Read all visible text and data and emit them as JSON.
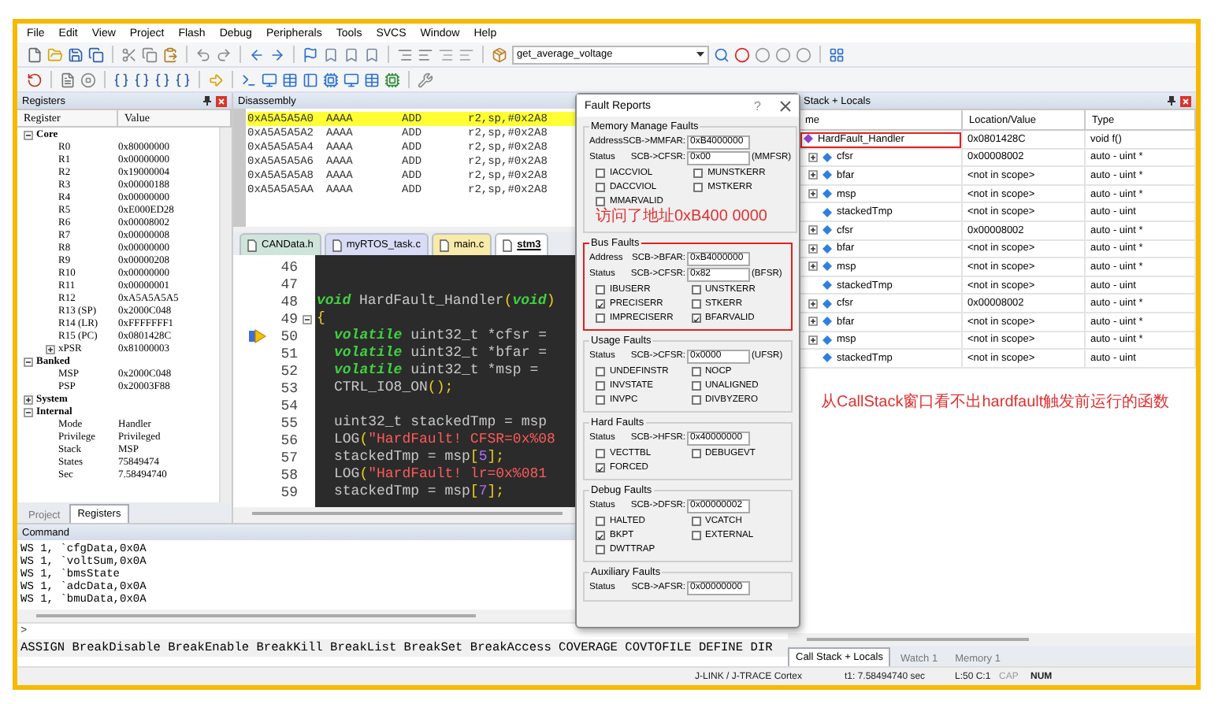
{
  "window": {
    "menu": [
      "File",
      "Edit",
      "View",
      "Project",
      "Flash",
      "Debug",
      "Peripherals",
      "Tools",
      "SVCS",
      "Window",
      "Help"
    ]
  },
  "toolbar": {
    "target": "get_average_voltage"
  },
  "registers": {
    "title": "Registers",
    "columns": [
      "Register",
      "Value"
    ],
    "items": [
      {
        "name": "Core",
        "expanded": true,
        "children": [
          {
            "name": "R0",
            "value": "0x80000000"
          },
          {
            "name": "R1",
            "value": "0x00000000"
          },
          {
            "name": "R2",
            "value": "0x19000004"
          },
          {
            "name": "R3",
            "value": "0x00000188"
          },
          {
            "name": "R4",
            "value": "0x00000000"
          },
          {
            "name": "R5",
            "value": "0xE000ED28"
          },
          {
            "name": "R6",
            "value": "0x00008002"
          },
          {
            "name": "R7",
            "value": "0x00000008"
          },
          {
            "name": "R8",
            "value": "0x00000000"
          },
          {
            "name": "R9",
            "value": "0x00000208"
          },
          {
            "name": "R10",
            "value": "0x00000000"
          },
          {
            "name": "R11",
            "value": "0x00000001"
          },
          {
            "name": "R12",
            "value": "0xA5A5A5A5"
          },
          {
            "name": "R13 (SP)",
            "value": "0x2000C048"
          },
          {
            "name": "R14 (LR)",
            "value": "0xFFFFFFF1"
          },
          {
            "name": "R15 (PC)",
            "value": "0x0801428C"
          },
          {
            "name": "xPSR",
            "value": "0x81000003",
            "expanded": false
          }
        ]
      },
      {
        "name": "Banked",
        "expanded": true,
        "children": [
          {
            "name": "MSP",
            "value": "0x2000C048"
          },
          {
            "name": "PSP",
            "value": "0x20003F88"
          }
        ]
      },
      {
        "name": "System",
        "expanded": false
      },
      {
        "name": "Internal",
        "expanded": true,
        "children": [
          {
            "name": "Mode",
            "value": "Handler"
          },
          {
            "name": "Privilege",
            "value": "Privileged"
          },
          {
            "name": "Stack",
            "value": "MSP"
          },
          {
            "name": "States",
            "value": "75849474"
          },
          {
            "name": "Sec",
            "value": "7.58494740"
          }
        ]
      }
    ],
    "tabs": [
      {
        "label": "Project",
        "selected": false
      },
      {
        "label": "Registers",
        "selected": true
      }
    ]
  },
  "disassembly": {
    "title": "Disassembly",
    "rows": [
      {
        "address": "0xA5A5A5A0",
        "opcode": "AAAA",
        "mnemonic": "ADD",
        "operands": "r2,sp,#0x2A8",
        "selected": true
      },
      {
        "address": "0xA5A5A5A2",
        "opcode": "AAAA",
        "mnemonic": "ADD",
        "operands": "r2,sp,#0x2A8",
        "selected": false
      },
      {
        "address": "0xA5A5A5A4",
        "opcode": "AAAA",
        "mnemonic": "ADD",
        "operands": "r2,sp,#0x2A8",
        "selected": false
      },
      {
        "address": "0xA5A5A5A6",
        "opcode": "AAAA",
        "mnemonic": "ADD",
        "operands": "r2,sp,#0x2A8",
        "selected": false
      },
      {
        "address": "0xA5A5A5A8",
        "opcode": "AAAA",
        "mnemonic": "ADD",
        "operands": "r2,sp,#0x2A8",
        "selected": false
      },
      {
        "address": "0xA5A5A5AA",
        "opcode": "AAAA",
        "mnemonic": "ADD",
        "operands": "r2,sp,#0x2A8",
        "selected": false
      }
    ]
  },
  "editor": {
    "tabs": [
      {
        "label": "CANData.h",
        "color": "#cfe5da",
        "selected": false
      },
      {
        "label": "myRTOS_task.c",
        "color": "#d9dcf5",
        "selected": false
      },
      {
        "label": "main.c",
        "color": "#f8eaa8",
        "selected": false
      },
      {
        "label": "stm3",
        "color": "#ffffff",
        "selected": true
      }
    ],
    "lines": [
      {
        "number": "46",
        "current": false,
        "fold": false
      },
      {
        "number": "47",
        "current": false,
        "fold": false
      },
      {
        "number": "48",
        "current": false,
        "fold": false,
        "indent": false,
        "tokens": [
          {
            "kind": "keyword",
            "t": "void"
          },
          {
            "kind": "text",
            "t": " HardFault_Handler"
          },
          {
            "kind": "punct",
            "t": "("
          },
          {
            "kind": "keyword",
            "t": "void"
          },
          {
            "kind": "punct",
            "t": ")"
          }
        ]
      },
      {
        "number": "49",
        "current": false,
        "fold": true,
        "indent": false,
        "tokens": [
          {
            "kind": "punct",
            "t": "{"
          }
        ]
      },
      {
        "number": "50",
        "current": true,
        "fold": false,
        "indent": true,
        "tokens": [
          {
            "kind": "keyword",
            "t": "volatile"
          },
          {
            "kind": "text",
            "t": " uint32_t *cfsr ="
          }
        ]
      },
      {
        "number": "51",
        "current": false,
        "fold": false,
        "indent": true,
        "tokens": [
          {
            "kind": "keyword",
            "t": "volatile"
          },
          {
            "kind": "text",
            "t": " uint32_t *bfar ="
          }
        ]
      },
      {
        "number": "52",
        "current": false,
        "fold": false,
        "indent": true,
        "tokens": [
          {
            "kind": "keyword",
            "t": "volatile"
          },
          {
            "kind": "text",
            "t": " uint32_t *msp ="
          }
        ]
      },
      {
        "number": "53",
        "current": false,
        "fold": false,
        "indent": true,
        "tokens": [
          {
            "kind": "text",
            "t": "CTRL_IO8_ON"
          },
          {
            "kind": "punct",
            "t": "();"
          }
        ]
      },
      {
        "number": "54",
        "current": false,
        "fold": false
      },
      {
        "number": "55",
        "current": false,
        "fold": false,
        "indent": true,
        "tokens": [
          {
            "kind": "text",
            "t": "uint32_t stackedTmp = msp"
          }
        ]
      },
      {
        "number": "56",
        "current": false,
        "fold": false,
        "indent": true,
        "tokens": [
          {
            "kind": "text",
            "t": "LOG"
          },
          {
            "kind": "punct",
            "t": "("
          },
          {
            "kind": "string",
            "t": "\"HardFault! CFSR=0x%08"
          }
        ]
      },
      {
        "number": "57",
        "current": false,
        "fold": false,
        "indent": true,
        "tokens": [
          {
            "kind": "text",
            "t": "stackedTmp = msp"
          },
          {
            "kind": "punct",
            "t": "["
          },
          {
            "kind": "number",
            "t": "5"
          },
          {
            "kind": "punct",
            "t": "];"
          }
        ]
      },
      {
        "number": "58",
        "current": false,
        "fold": false,
        "indent": true,
        "tokens": [
          {
            "kind": "text",
            "t": "LOG"
          },
          {
            "kind": "punct",
            "t": "("
          },
          {
            "kind": "string",
            "t": "\"HardFault! lr=0x%081"
          }
        ]
      },
      {
        "number": "59",
        "current": false,
        "fold": false,
        "indent": true,
        "tokens": [
          {
            "kind": "text",
            "t": "stackedTmp = msp"
          },
          {
            "kind": "punct",
            "t": "["
          },
          {
            "kind": "number",
            "t": "7"
          },
          {
            "kind": "punct",
            "t": "];"
          }
        ]
      }
    ]
  },
  "command": {
    "title": "Command",
    "lines": [
      "WS 1, `cfgData,0x0A",
      "WS 1, `voltSum,0x0A",
      "WS 1, `bmsState",
      "WS 1, `adcData,0x0A",
      "WS 1, `bmuData,0x0A"
    ],
    "prompt": ">",
    "hint": "ASSIGN BreakDisable BreakEnable BreakKill BreakList BreakSet BreakAccess COVERAGE COVTOFILE DEFINE DIR"
  },
  "fault_reports": {
    "title": "Fault Reports",
    "help": "?",
    "groups": [
      {
        "title": "Memory Manage Faults",
        "highlighted": false,
        "fields": [
          {
            "label": "Address",
            "register": "SCB->MMFAR:",
            "value": "0xB4000000"
          },
          {
            "label": "Status",
            "register": "SCB->CFSR:",
            "value": "0x00",
            "suffix": "(MMFSR)"
          }
        ],
        "flags": [
          {
            "name": "IACCVIOL",
            "checked": false
          },
          {
            "name": "MUNSTKERR",
            "checked": false
          },
          {
            "name": "DACCVIOL",
            "checked": false
          },
          {
            "name": "MSTKERR",
            "checked": false
          },
          {
            "name": "MMARVALID",
            "checked": false
          }
        ],
        "annotation": "访问了地址0xB400 0000"
      },
      {
        "title": "Bus Faults",
        "highlighted": true,
        "fields": [
          {
            "label": "Address",
            "register": "SCB->BFAR:",
            "value": "0xB4000000"
          },
          {
            "label": "Status",
            "register": "SCB->CFSR:",
            "value": "0x82",
            "suffix": "(BFSR)"
          }
        ],
        "flags": [
          {
            "name": "IBUSERR",
            "checked": false
          },
          {
            "name": "UNSTKERR",
            "checked": false
          },
          {
            "name": "PRECISERR",
            "checked": true
          },
          {
            "name": "STKERR",
            "checked": false
          },
          {
            "name": "IMPRECISERR",
            "checked": false
          },
          {
            "name": "BFARVALID",
            "checked": true
          }
        ]
      },
      {
        "title": "Usage Faults",
        "highlighted": false,
        "fields": [
          {
            "label": "Status",
            "register": "SCB->CFSR:",
            "value": "0x0000",
            "suffix": "(UFSR)"
          }
        ],
        "flags": [
          {
            "name": "UNDEFINSTR",
            "checked": false
          },
          {
            "name": "NOCP",
            "checked": false
          },
          {
            "name": "INVSTATE",
            "checked": false
          },
          {
            "name": "UNALIGNED",
            "checked": false
          },
          {
            "name": "INVPC",
            "checked": false
          },
          {
            "name": "DIVBYZERO",
            "checked": false
          }
        ]
      },
      {
        "title": "Hard Faults",
        "highlighted": false,
        "fields": [
          {
            "label": "Status",
            "register": "SCB->HFSR:",
            "value": "0x40000000"
          }
        ],
        "flags": [
          {
            "name": "VECTTBL",
            "checked": false
          },
          {
            "name": "DEBUGEVT",
            "checked": false
          },
          {
            "name": "FORCED",
            "checked": true
          }
        ]
      },
      {
        "title": "Debug Faults",
        "highlighted": false,
        "fields": [
          {
            "label": "Status",
            "register": "SCB->DFSR:",
            "value": "0x00000002"
          }
        ],
        "flags": [
          {
            "name": "HALTED",
            "checked": false
          },
          {
            "name": "VCATCH",
            "checked": false
          },
          {
            "name": "BKPT",
            "checked": true
          },
          {
            "name": "EXTERNAL",
            "checked": false
          },
          {
            "name": "DWTTRAP",
            "checked": false
          }
        ]
      },
      {
        "title": "Auxiliary Faults",
        "highlighted": false,
        "fields": [
          {
            "label": "Status",
            "register": "SCB->AFSR:",
            "value": "0x00000000"
          }
        ]
      }
    ]
  },
  "call_stack": {
    "title": "Stack + Locals",
    "columns": [
      "me",
      "Location/Value",
      "Type"
    ],
    "rows": [
      {
        "name": "HardFault_Handler",
        "value": "0x0801428C",
        "type": "void f()",
        "highlighted": true,
        "children": [
          {
            "name": "cfsr",
            "value": "0x00008002",
            "type": "auto - uint *",
            "expanded": false
          },
          {
            "name": "bfar",
            "value": "<not in scope>",
            "type": "auto - uint *",
            "expanded": false
          },
          {
            "name": "msp",
            "value": "<not in scope>",
            "type": "auto - uint *",
            "expanded": false
          },
          {
            "name": "stackedTmp",
            "value": "<not in scope>",
            "type": "auto - uint"
          },
          {
            "name": "cfsr",
            "value": "0x00008002",
            "type": "auto - uint *",
            "expanded": false
          },
          {
            "name": "bfar",
            "value": "<not in scope>",
            "type": "auto - uint *",
            "expanded": false
          },
          {
            "name": "msp",
            "value": "<not in scope>",
            "type": "auto - uint *",
            "expanded": false
          },
          {
            "name": "stackedTmp",
            "value": "<not in scope>",
            "type": "auto - uint"
          },
          {
            "name": "cfsr",
            "value": "0x00008002",
            "type": "auto - uint *",
            "expanded": false
          },
          {
            "name": "bfar",
            "value": "<not in scope>",
            "type": "auto - uint *",
            "expanded": false
          },
          {
            "name": "msp",
            "value": "<not in scope>",
            "type": "auto - uint *",
            "expanded": false
          },
          {
            "name": "stackedTmp",
            "value": "<not in scope>",
            "type": "auto - uint"
          }
        ]
      }
    ],
    "note": "从CallStack窗口看不出hardfault触发前运行的函数",
    "tabs": [
      {
        "label": "Call Stack + Locals",
        "selected": true
      },
      {
        "label": "Watch 1",
        "selected": false
      },
      {
        "label": "Memory 1",
        "selected": false
      }
    ]
  },
  "status_bar": {
    "debugger": "J-LINK / J-TRACE Cortex",
    "time": "t1: 7.58494740 sec",
    "position": "L:50 C:1",
    "keys": [
      {
        "label": "CAP",
        "on": false
      },
      {
        "label": "NUM",
        "on": true
      }
    ]
  }
}
